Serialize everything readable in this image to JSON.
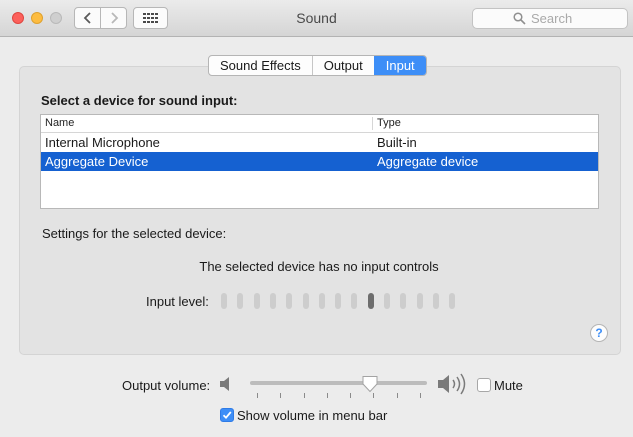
{
  "window": {
    "title": "Sound",
    "search_placeholder": "Search"
  },
  "icons": {
    "back": "chevron-left-icon",
    "forward": "chevron-right-icon",
    "show_all": "grid-icon",
    "search": "search-icon",
    "help": "help-icon",
    "speaker_low": "speaker-low-icon",
    "speaker_high": "speaker-high-icon"
  },
  "tabs": {
    "items": [
      "Sound Effects",
      "Output",
      "Input"
    ],
    "active": "Input"
  },
  "input": {
    "heading": "Select a device for sound input:",
    "table": {
      "columns": [
        "Name",
        "Type"
      ],
      "rows": [
        {
          "name": "Internal Microphone",
          "type": "Built-in",
          "selected": false
        },
        {
          "name": "Aggregate Device",
          "type": "Aggregate device",
          "selected": true
        }
      ]
    },
    "settings_label": "Settings for the selected device:",
    "no_controls": "The selected device has no input controls",
    "level_label": "Input level:",
    "level": {
      "segments": 15,
      "active_segment": 10
    },
    "help": "?"
  },
  "output_volume": {
    "label": "Output volume:",
    "value": 0.7,
    "mute_label": "Mute",
    "muted": false,
    "show_in_menu_bar_label": "Show volume in menu bar",
    "show_in_menu_bar": true
  },
  "colors": {
    "accent": "#3d8ef7",
    "selection": "#1561d1",
    "close": "#fc605b",
    "minimize": "#fdbc40",
    "zoom_disabled": "#cfcfcf"
  }
}
